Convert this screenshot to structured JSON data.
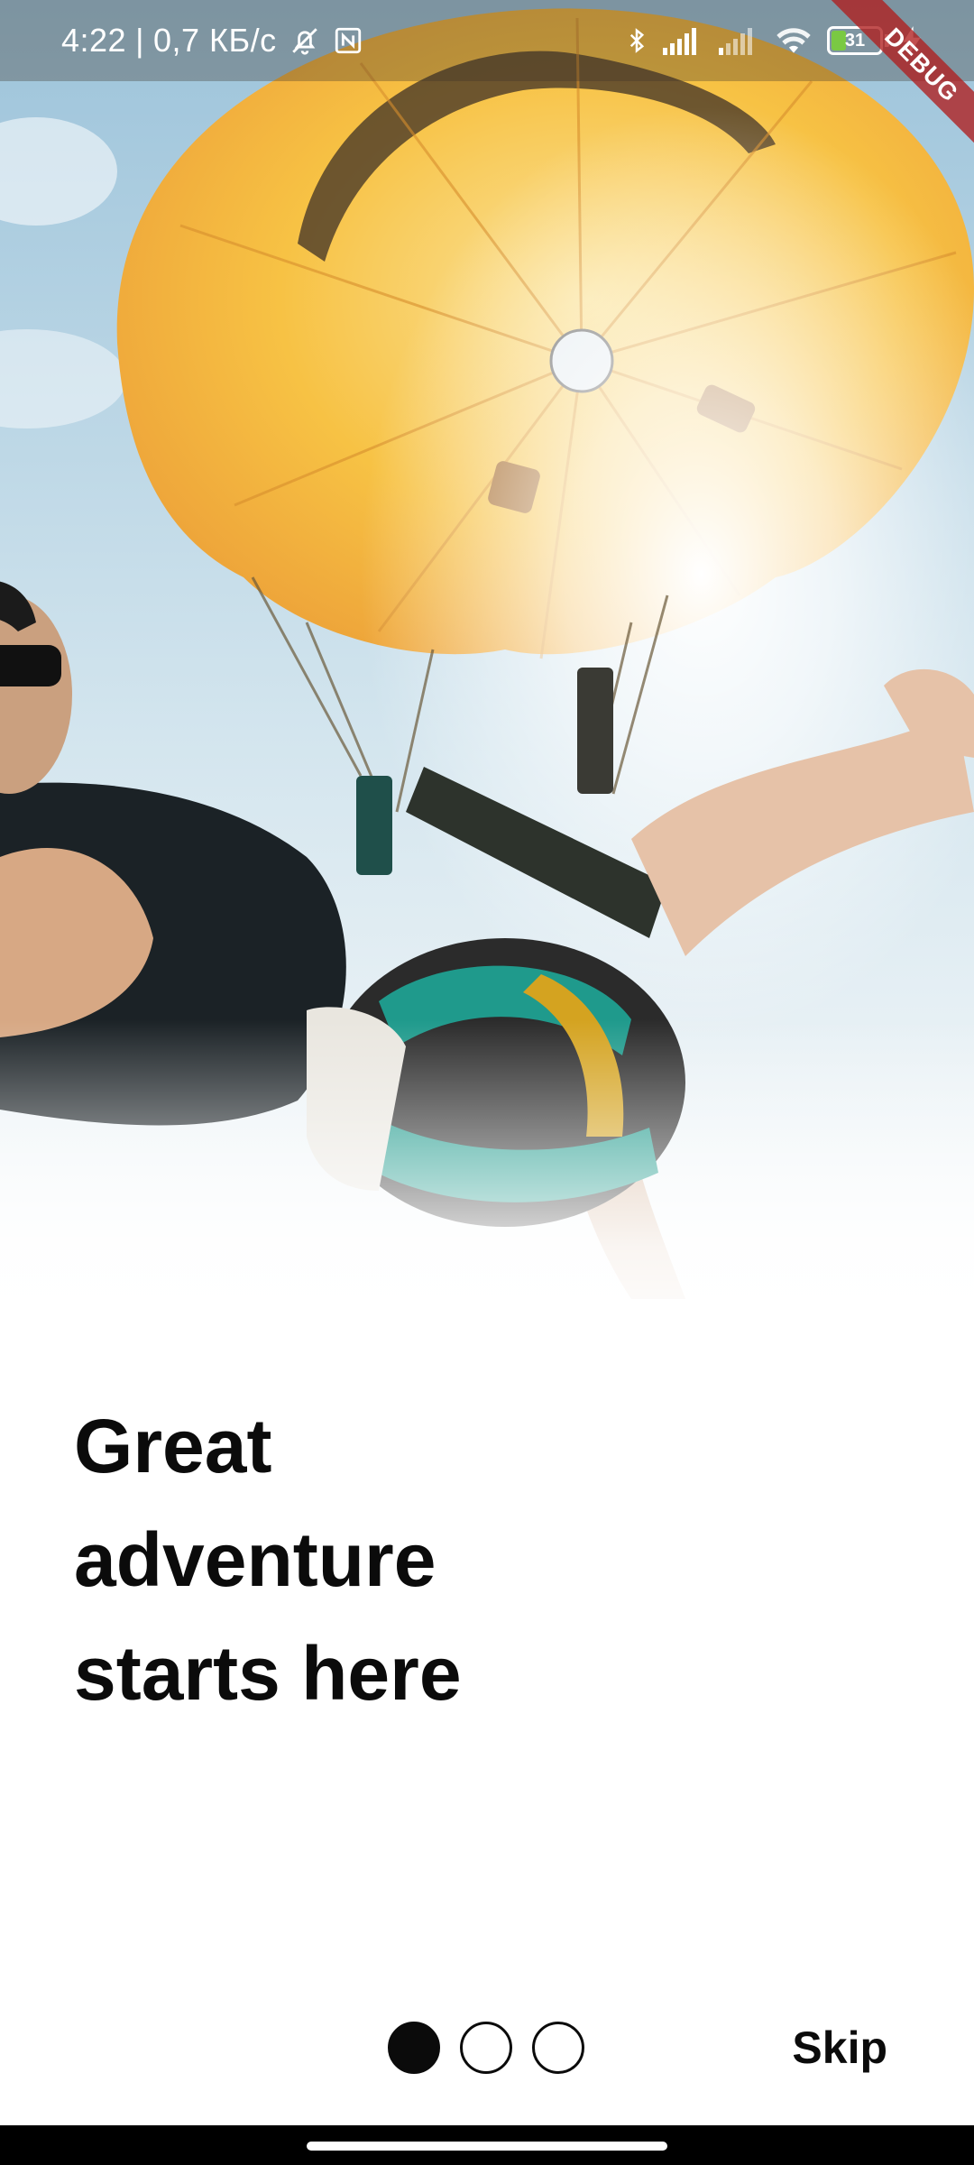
{
  "status_bar": {
    "time": "4:22",
    "separator": "|",
    "network_speed": "0,7 КБ/с",
    "battery_level": "31",
    "battery_fraction": 0.31,
    "icons": [
      "bell-off-icon",
      "nfc-icon",
      "bluetooth-icon",
      "signal-icon",
      "signal-weak-icon",
      "wifi-icon",
      "battery-icon",
      "charging-icon"
    ]
  },
  "debug_banner": "DEBUG",
  "hero_image": {
    "subject": "parasailing",
    "icon": "hero-photo"
  },
  "onboarding": {
    "headline": "Great\nadventure\nstarts here",
    "pages": [
      {
        "active": true
      },
      {
        "active": false
      },
      {
        "active": false
      }
    ],
    "skip_label": "Skip"
  },
  "colors": {
    "text": "#0b0b0b",
    "canopy": "#f7c244",
    "sky": "#bcd7e6",
    "battery_fill": "#7ac943",
    "debug": "#b01e1e"
  }
}
